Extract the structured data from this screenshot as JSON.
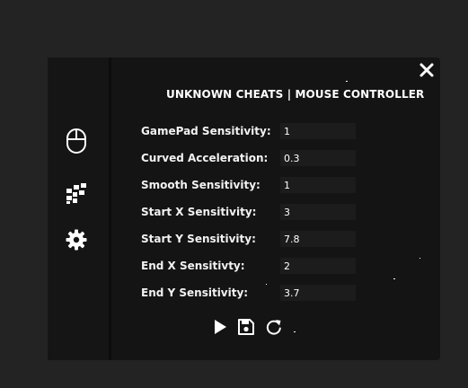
{
  "window": {
    "title": "UNKNOWN CHEATS | MOUSE CONTROLLER"
  },
  "sidebar": {
    "items": [
      {
        "icon": "mouse-icon"
      },
      {
        "icon": "grid-icon"
      },
      {
        "icon": "gear-icon"
      }
    ]
  },
  "settings": [
    {
      "label": "GamePad Sensitivity:",
      "value": "1"
    },
    {
      "label": "Curved Acceleration:",
      "value": "0.3"
    },
    {
      "label": "Smooth Sensitivity:",
      "value": "1"
    },
    {
      "label": "Start X Sensitivity:",
      "value": "3"
    },
    {
      "label": "Start Y Sensitivity:",
      "value": "7.8"
    },
    {
      "label": "End X Sensitivty:",
      "value": "2"
    },
    {
      "label": "End Y Sensitivity:",
      "value": "3.7"
    }
  ],
  "actions": [
    {
      "icon": "play-icon"
    },
    {
      "icon": "save-icon"
    },
    {
      "icon": "refresh-icon"
    }
  ],
  "colors": {
    "background": "#232323",
    "panel": "#141414",
    "input": "#1c1c1c",
    "text": "#ffffff"
  }
}
